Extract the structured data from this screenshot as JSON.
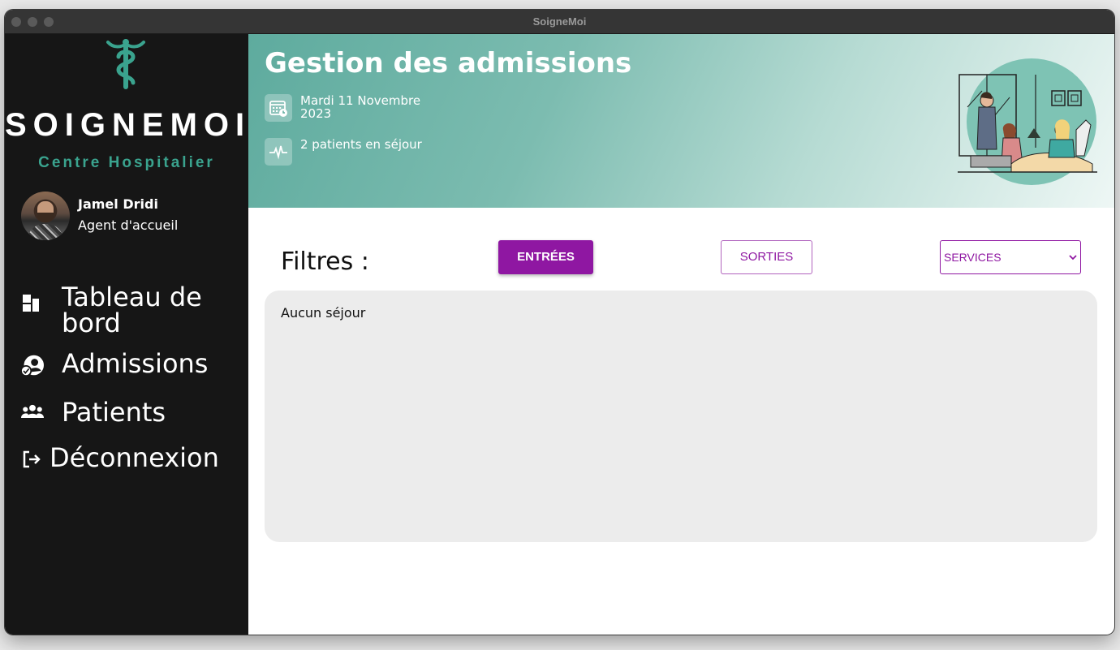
{
  "window": {
    "title": "SoigneMoi"
  },
  "sidebar": {
    "brand": "SOIGNEMOI",
    "brand_sub": "Centre Hospitalier",
    "user": {
      "name": "Jamel Dridi",
      "role": "Agent d'accueil"
    },
    "nav": [
      {
        "label": "Tableau de bord",
        "icon": "dashboard-icon"
      },
      {
        "label": "Admissions",
        "icon": "admission-user-check-icon"
      },
      {
        "label": "Patients",
        "icon": "users-group-icon"
      },
      {
        "label": "Déconnexion",
        "icon": "logout-icon"
      }
    ]
  },
  "header": {
    "title": "Gestion des admissions",
    "date": "Mardi 11 Novembre 2023",
    "patients": "2 patients en séjour"
  },
  "filters": {
    "label": "Filtres :",
    "entries": "ENTRÉES",
    "exits": "SORTIES",
    "services": "SERVICES"
  },
  "content": {
    "empty_message": "Aucun séjour"
  },
  "colors": {
    "accent": "#8f17a2",
    "teal": "#3aa38e",
    "sidebar": "#161616"
  }
}
